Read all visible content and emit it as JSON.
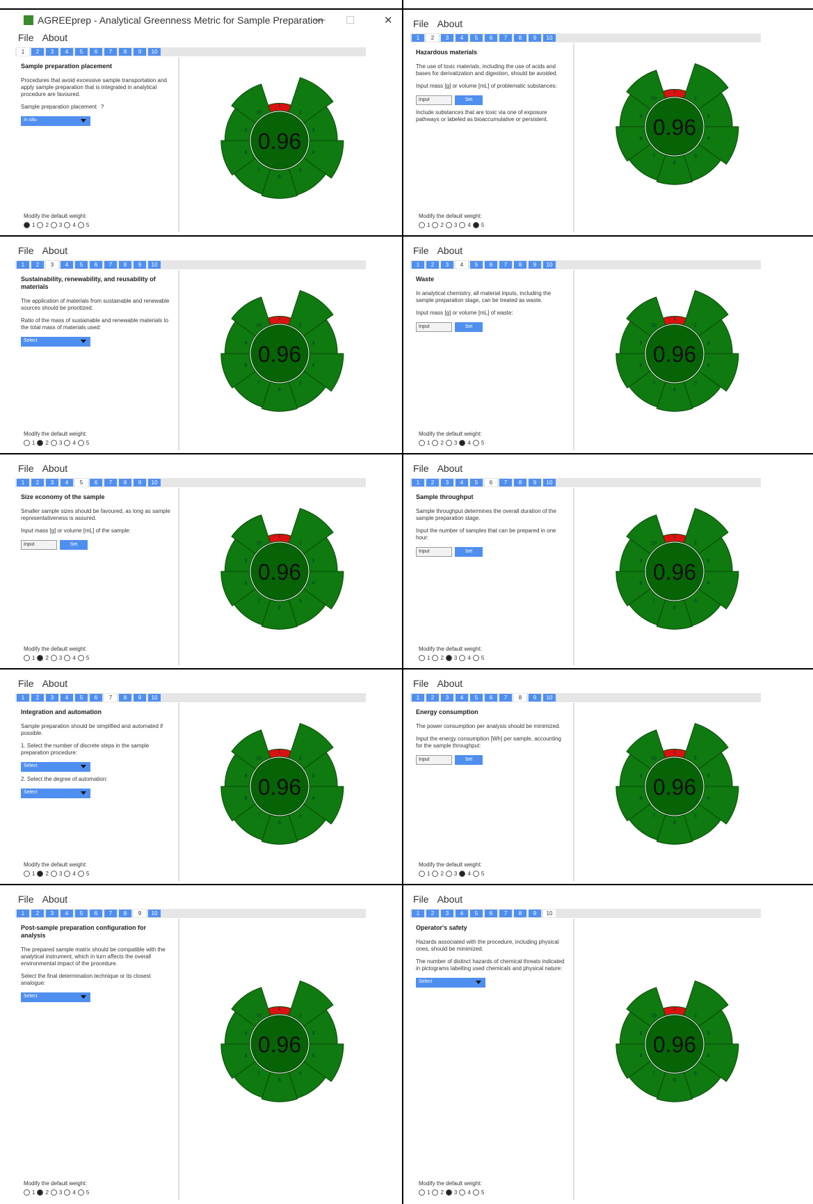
{
  "app": {
    "window_title": "AGREEprep - Analytical Greenness Metric for Sample Preparation",
    "menu": [
      "File",
      "About"
    ],
    "minimize_glyph": "—",
    "maximize_glyph": "☐",
    "close_glyph": "✕"
  },
  "common": {
    "tabs": [
      "1",
      "2",
      "3",
      "4",
      "5",
      "6",
      "7",
      "8",
      "9",
      "10"
    ],
    "score": "0.96",
    "weight_label": "Modify the default weight:",
    "weight_options": [
      "1",
      "2",
      "3",
      "4",
      "5"
    ],
    "input_placeholder": "Input",
    "set_label": "Set"
  },
  "colors": {
    "segment_green": "#0f7a0f",
    "segment_red": "#dd1111",
    "center_green": "#066306",
    "tab_blue": "#4f8ff0"
  },
  "panels": [
    {
      "active_tab": 0,
      "heading": "Sample preparation placement",
      "description": "Procedures that avoid excessive sample transportation and apply sample preparation that is integrated in analytical procedure are favoured.",
      "question": "Sample preparation placement",
      "question_mark": "?",
      "control": "dropdown",
      "dropdown_value": "In situ",
      "weight": 1,
      "has_titlebar": true
    },
    {
      "active_tab": 1,
      "heading": "Hazardous materials",
      "description": "The use of toxic materials, including the use of acids and bases for derivatization and digestion, should be avoided.",
      "question": "Input mass [g] or volume [mL] of problematic substances:",
      "control": "input",
      "extra": "Include substances that are toxic via one of exposure pathways or labeled as bioaccumulative or persistent.",
      "weight": 5
    },
    {
      "active_tab": 2,
      "heading": "Sustainability, renewability, and reusability of materials",
      "description": "The application of materials from sustainable and renewable sources should be prioritized.",
      "question": "Ratio of the mass of sustainable and renewable materials to the total mass of materials used:",
      "control": "dropdown",
      "dropdown_value": "Select",
      "weight": 2
    },
    {
      "active_tab": 3,
      "heading": "Waste",
      "description": "In analytical chemistry, all material inputs, including the sample preparation stage, can be treated as waste.",
      "question": "Input mass [g] or volume [mL] of waste:",
      "control": "input",
      "weight": 4
    },
    {
      "active_tab": 4,
      "heading": "Size economy of the sample",
      "description": "Smaller sample sizes should be favoured, as long as sample representativeness is assured.",
      "question": "Input mass [g] or volume [mL] of the sample:",
      "control": "input",
      "weight": 2
    },
    {
      "active_tab": 5,
      "heading": "Sample throughput",
      "description": "Sample throughput determines the overall duration of the sample preparation stage.",
      "question": "Input the number of samples that can be prepared in one hour:",
      "control": "input",
      "weight": 3
    },
    {
      "active_tab": 6,
      "heading": "Integration and automation",
      "description": "Sample preparation should be simplified and automated if possible.",
      "question": "1. Select the number of discrete steps in the sample preparation procedure:",
      "control": "dropdown2",
      "dropdown_value": "Select",
      "question2": "2. Select the degree of automation:",
      "weight": 2
    },
    {
      "active_tab": 7,
      "heading": "Energy consumption",
      "description": "The power consumption per analysis should be minimized.",
      "question": "Input the energy consumption [Wh] per sample, accounting for the sample throughput:",
      "control": "input",
      "weight": 4
    },
    {
      "active_tab": 8,
      "heading": "Post-sample preparation configuration for analysis",
      "description": "The prepared sample matrix should be compatible with the analytical instrument, which in turn affects the overall environmental impact of the procedure.",
      "question": "Select the final determination technique or its closest analogue:",
      "control": "dropdown",
      "dropdown_value": "Select",
      "weight": 2
    },
    {
      "active_tab": 9,
      "heading": "Operator's safety",
      "description": "Hazards associated with the procedure, including physical ones, should be minimized.",
      "question": "The number of distinct hazards of chemical threats indicated in pictograms labelling used chemicals and physical nature:",
      "control": "dropdown",
      "dropdown_value": "Select",
      "weight": 3
    }
  ]
}
